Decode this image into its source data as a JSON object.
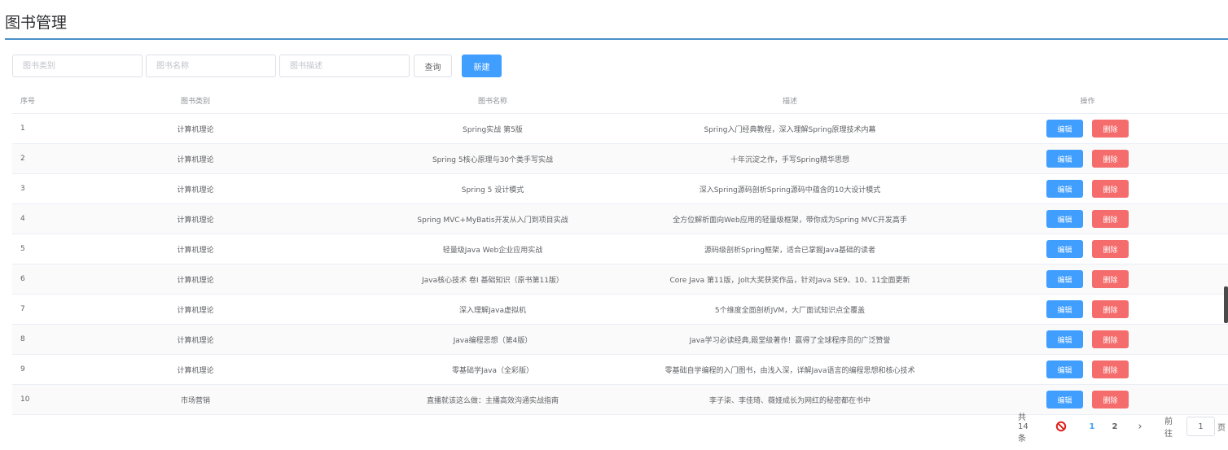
{
  "page": {
    "title": "图书管理"
  },
  "search": {
    "category_placeholder": "图书类别",
    "name_placeholder": "图书名称",
    "desc_placeholder": "图书描述",
    "query_label": "查询",
    "new_label": "新建"
  },
  "table": {
    "headers": {
      "index": "序号",
      "category": "图书类别",
      "name": "图书名称",
      "description": "描述",
      "actions": "操作"
    },
    "edit_label": "编辑",
    "delete_label": "删除",
    "rows": [
      {
        "index": "1",
        "category": "计算机理论",
        "name": "Spring实战 第5版",
        "description": "Spring入门经典教程，深入理解Spring原理技术内幕"
      },
      {
        "index": "2",
        "category": "计算机理论",
        "name": "Spring 5核心原理与30个类手写实战",
        "description": "十年沉淀之作，手写Spring精华思想"
      },
      {
        "index": "3",
        "category": "计算机理论",
        "name": "Spring 5 设计模式",
        "description": "深入Spring源码剖析Spring源码中蕴含的10大设计模式"
      },
      {
        "index": "4",
        "category": "计算机理论",
        "name": "Spring MVC+MyBatis开发从入门到项目实战",
        "description": "全方位解析面向Web应用的轻量级框架，带你成为Spring MVC开发高手"
      },
      {
        "index": "5",
        "category": "计算机理论",
        "name": "轻量级Java Web企业应用实战",
        "description": "源码级剖析Spring框架，适合已掌握Java基础的读者"
      },
      {
        "index": "6",
        "category": "计算机理论",
        "name": "Java核心技术 卷I 基础知识（原书第11版）",
        "description": "Core Java 第11版，Jolt大奖获奖作品，针对Java SE9、10、11全面更新"
      },
      {
        "index": "7",
        "category": "计算机理论",
        "name": "深入理解Java虚拟机",
        "description": "5个维度全面剖析JVM，大厂面试知识点全覆盖"
      },
      {
        "index": "8",
        "category": "计算机理论",
        "name": "Java编程思想（第4版）",
        "description": "Java学习必读经典,殿堂级著作！赢得了全球程序员的广泛赞誉"
      },
      {
        "index": "9",
        "category": "计算机理论",
        "name": "零基础学Java（全彩版）",
        "description": "零基础自学编程的入门图书，由浅入深，详解Java语言的编程思想和核心技术"
      },
      {
        "index": "10",
        "category": "市场营销",
        "name": "直播就该这么做：主播高效沟通实战指南",
        "description": "李子柒、李佳琦、薇娅成长为网红的秘密都在书中"
      }
    ]
  },
  "pagination": {
    "total_text": "共 14 条",
    "pages": [
      "1",
      "2"
    ],
    "current_page": "1",
    "goto_label": "前往",
    "jump_value": "1",
    "unit_label": "页",
    "next_icon": "chevron-right-icon",
    "prev_icon": "not-allowed-icon"
  },
  "colors": {
    "primary": "#409eff",
    "danger": "#f56c6c",
    "title_rule": "#4a90c8"
  }
}
